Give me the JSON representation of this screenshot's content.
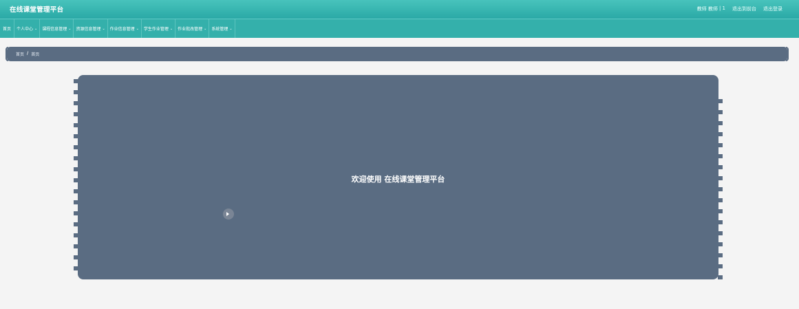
{
  "app": {
    "title": "在线课堂管理平台"
  },
  "header": {
    "user_role": "教师 教师",
    "user_id": "| 1",
    "back_home": "退出到前台",
    "logout": "退出登录"
  },
  "nav": {
    "items": [
      {
        "label": "首页",
        "dropdown": false
      },
      {
        "label": "个人中心",
        "dropdown": true
      },
      {
        "label": "课程信息管理",
        "dropdown": true
      },
      {
        "label": "资源信息管理",
        "dropdown": true
      },
      {
        "label": "作业信息管理",
        "dropdown": true
      },
      {
        "label": "学生作业管理",
        "dropdown": true
      },
      {
        "label": "作业批改管理",
        "dropdown": true
      },
      {
        "label": "系统管理",
        "dropdown": true
      }
    ]
  },
  "breadcrumb": {
    "root": "首页",
    "separator": "/",
    "current": "首页"
  },
  "main": {
    "welcome": "欢迎使用 在线课堂管理平台"
  },
  "colors": {
    "header": "#2aa9a6",
    "nav": "#34b0ab",
    "panel": "#5a6c82",
    "background": "#f4f4f4"
  }
}
